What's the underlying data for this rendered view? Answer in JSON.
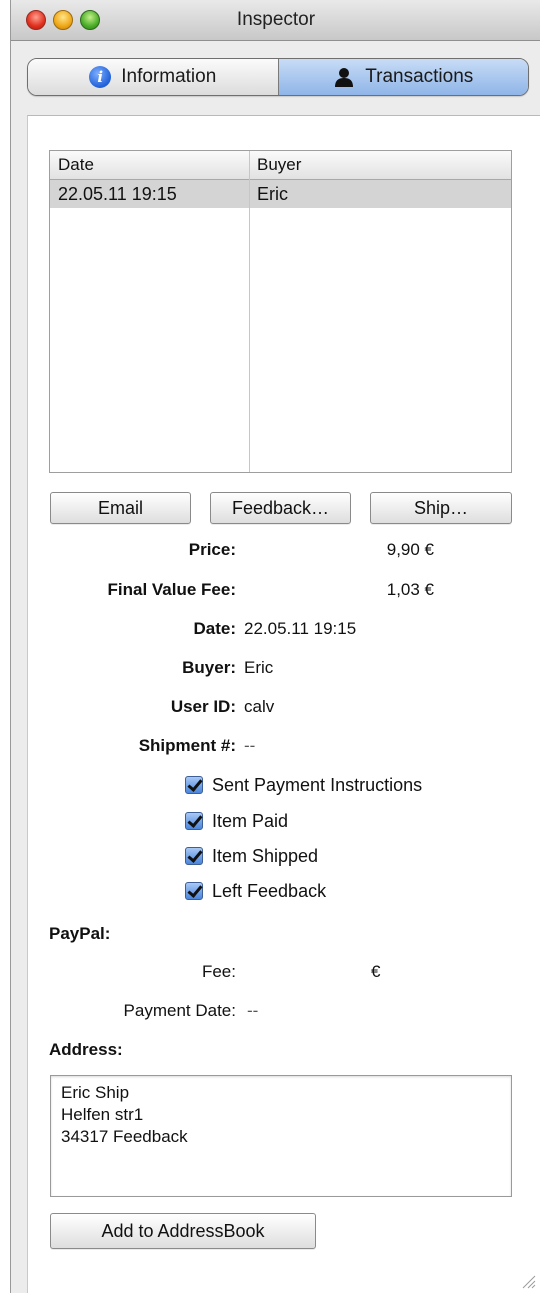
{
  "window": {
    "title": "Inspector"
  },
  "tabs": [
    {
      "label": "Information",
      "icon": "info-icon",
      "active": false
    },
    {
      "label": "Transactions",
      "icon": "person-icon",
      "active": true
    }
  ],
  "transactions_table": {
    "columns": [
      "Date",
      "Buyer"
    ],
    "rows": [
      {
        "date": "22.05.11 19:15",
        "buyer": "Eric"
      }
    ]
  },
  "actions": {
    "email": "Email",
    "feedback": "Feedback…",
    "ship": "Ship…"
  },
  "details": {
    "price_label": "Price:",
    "price_value": "9,90 €",
    "fee_label": "Final Value Fee:",
    "fee_value": "1,03 €",
    "date_label": "Date:",
    "date_value": "22.05.11 19:15",
    "buyer_label": "Buyer:",
    "buyer_value": "Eric",
    "userid_label": "User ID:",
    "userid_value": "calv",
    "shipment_label": "Shipment #:",
    "shipment_value": "--"
  },
  "checkboxes": [
    {
      "label": "Sent Payment Instructions",
      "checked": true
    },
    {
      "label": "Item Paid",
      "checked": true
    },
    {
      "label": "Item Shipped",
      "checked": true
    },
    {
      "label": "Left Feedback",
      "checked": true
    }
  ],
  "paypal": {
    "heading": "PayPal:",
    "fee_label": "Fee:",
    "fee_currency": "€",
    "payment_date_label": "Payment Date:",
    "payment_date_value": "--"
  },
  "address": {
    "heading": "Address:",
    "lines": [
      "Eric Ship",
      "Helfen str1",
      "34317 Feedback"
    ]
  },
  "add_to_addressbook": "Add to AddressBook",
  "colors": {
    "active_tab": "#9dbdec",
    "checkbox": "#4a86dd"
  }
}
